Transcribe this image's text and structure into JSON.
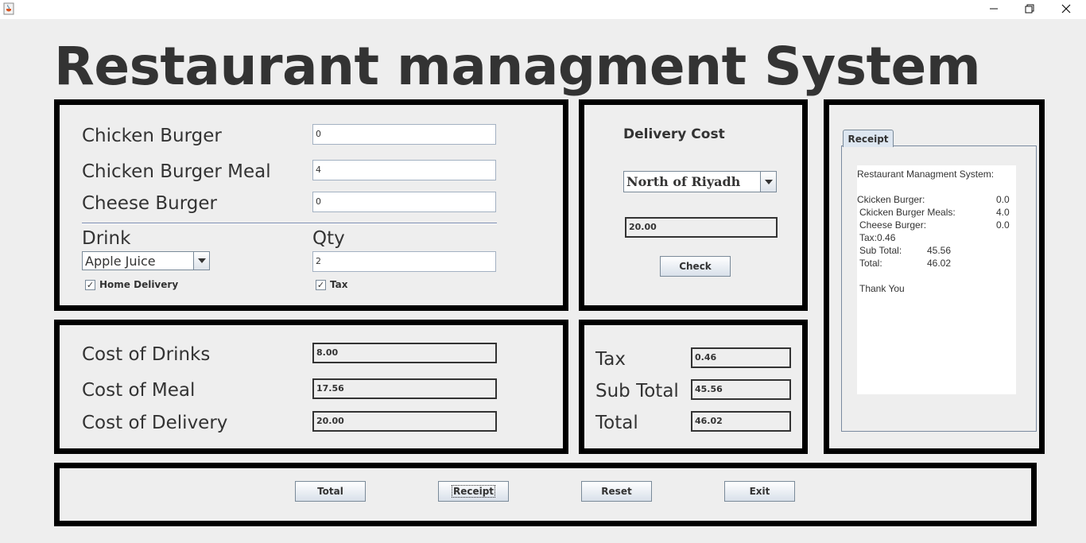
{
  "window": {
    "app_icon": "java-coffee-icon",
    "controls": [
      "minimize-icon",
      "restore-icon",
      "close-icon"
    ]
  },
  "title": "Restaurant managment System",
  "order": {
    "items": [
      {
        "label": "Chicken Burger",
        "qty": "0"
      },
      {
        "label": "Chicken Burger Meal",
        "qty": "4"
      },
      {
        "label": "Cheese Burger",
        "qty": "0"
      }
    ],
    "drink_label": "Drink",
    "qty_label": "Qty",
    "drink_selected": "Apple Juice",
    "drink_qty": "2",
    "home_delivery_label": "Home Delivery",
    "home_delivery_checked": true,
    "tax_label": "Tax",
    "tax_checked": true
  },
  "delivery": {
    "heading": "Delivery Cost",
    "region_selected": "North of Riyadh",
    "cost": "20.00",
    "check_label": "Check"
  },
  "costs": {
    "drinks_label": "Cost of Drinks",
    "drinks_value": "8.00",
    "meal_label": "Cost of Meal",
    "meal_value": "17.56",
    "delivery_label": "Cost of Delivery",
    "delivery_value": "20.00"
  },
  "totals": {
    "tax_label": "Tax",
    "tax_value": "0.46",
    "subtotal_label": "Sub Total",
    "subtotal_value": "45.56",
    "total_label": "Total",
    "total_value": "46.02"
  },
  "receipt": {
    "tab_label": "Receipt",
    "header": "Restaurant Managment System:",
    "chicken_burger_label": "Ckicken Burger:",
    "chicken_burger_value": "0.0",
    "meals_label": "Ckicken Burger Meals:",
    "meals_value": "4.0",
    "cheese_label": "Cheese Burger:",
    "cheese_value": "0.0",
    "tax_line": "Tax:0.46",
    "subtotal_label": "Sub Total:",
    "subtotal_value": "45.56",
    "total_label": "Total:",
    "total_value": "46.02",
    "thanks": "Thank You"
  },
  "actions": {
    "total": "Total",
    "receipt": "Receipt",
    "reset": "Reset",
    "exit": "Exit"
  }
}
